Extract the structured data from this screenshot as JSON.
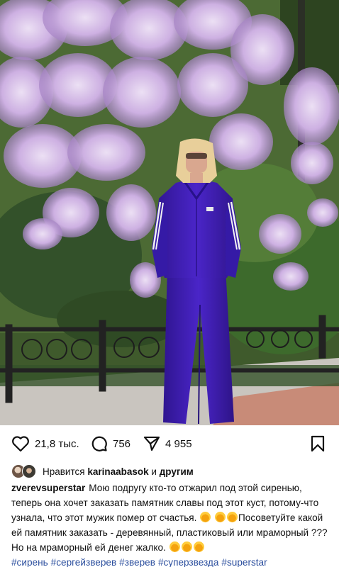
{
  "colors": {
    "hashtag": "#2c4f9e",
    "text": "#111111",
    "tracksuit": "#3f1fb4",
    "lilac": "#c7a6de"
  },
  "actions": {
    "like_icon": "heart-icon",
    "like_count": "21,8 тыс.",
    "comment_icon": "comment-icon",
    "comment_count": "756",
    "share_icon": "send-icon",
    "share_count": "4 955",
    "save_icon": "bookmark-icon"
  },
  "likes": {
    "prefix": "Нравится",
    "user": "karinaabasok",
    "and": "и",
    "others": "другим"
  },
  "caption": {
    "username": "zverevsuperstar",
    "text1": "Мою подругу кто-то отжарил под этой сиренью, теперь она хочет заказать памятник славы под этот куст, потому-что узнала, что этот мужик помер от счастья.",
    "text2": "Посоветуйте какой ей памятник заказать - деревянный, пластиковый или мраморный ??? Но на мраморный ей денег жалко.",
    "hashtags": [
      "#сирень",
      "#сергейзверев",
      "#зверев",
      "#суперзвезда",
      "#superstar"
    ]
  }
}
